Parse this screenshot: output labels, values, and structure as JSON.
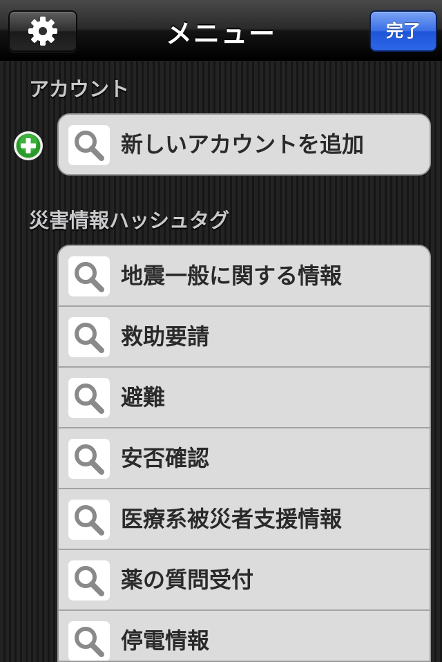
{
  "navbar": {
    "title": "メニュー",
    "done_label": "完了",
    "settings_icon": "gear-icon"
  },
  "account_section": {
    "header": "アカウント",
    "add_account_label": "新しいアカウントを追加",
    "add_icon": "plus-circle-icon"
  },
  "hashtag_section": {
    "header": "災害情報ハッシュタグ",
    "items": [
      {
        "label": "地震一般に関する情報"
      },
      {
        "label": "救助要請"
      },
      {
        "label": "避難"
      },
      {
        "label": "安否確認"
      },
      {
        "label": "医療系被災者支援情報"
      },
      {
        "label": "薬の質問受付"
      },
      {
        "label": "停電情報"
      }
    ]
  },
  "colors": {
    "accent_blue": "#2d66e8",
    "add_green": "#2a9a2a",
    "row_background": "#dcdcdc"
  }
}
